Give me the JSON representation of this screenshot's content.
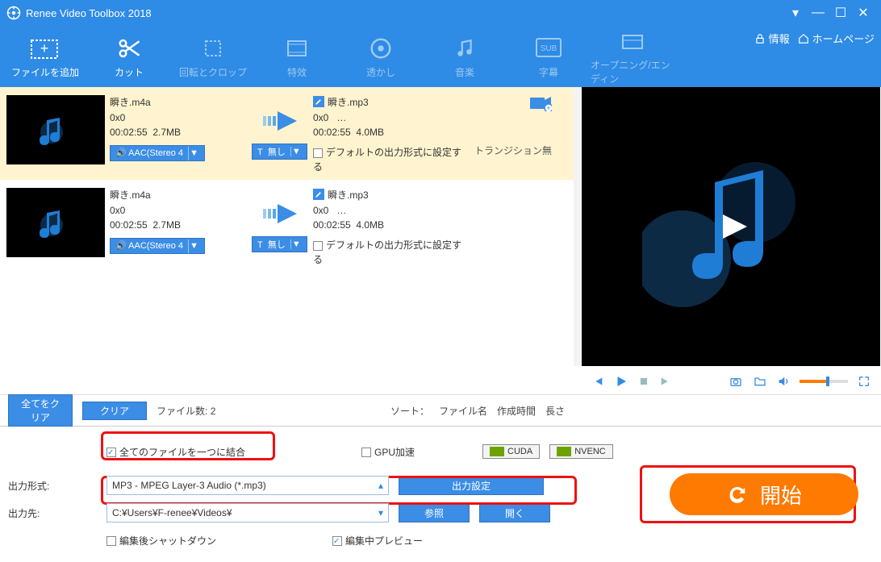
{
  "title": "Renee Video Toolbox 2018",
  "header_links": {
    "info": "情報",
    "home": "ホームページ"
  },
  "tools": [
    {
      "label": "ファイルを追加",
      "active": true
    },
    {
      "label": "カット",
      "active": true
    },
    {
      "label": "回転とクロップ",
      "active": false
    },
    {
      "label": "特效",
      "active": false
    },
    {
      "label": "透かし",
      "active": false
    },
    {
      "label": "音楽",
      "active": false
    },
    {
      "label": "字幕",
      "active": false
    },
    {
      "label": "オープニング/エンディン",
      "active": false
    }
  ],
  "files": [
    {
      "selected": true,
      "src_name": "瞬き.m4a",
      "src_res": "0x0",
      "src_dur": "00:02:55",
      "src_size": "2.7MB",
      "dst_name": "瞬き.mp3",
      "dst_res": "0x0",
      "dst_extra": "…",
      "dst_dur": "00:02:55",
      "dst_size": "4.0MB",
      "transition": "トランジション無",
      "audio_sel": "AAC(Stereo 4",
      "sub_sel": "無し",
      "default_fmt": "デフォルトの出力形式に設定する"
    },
    {
      "selected": false,
      "src_name": "瞬き.m4a",
      "src_res": "0x0",
      "src_dur": "00:02:55",
      "src_size": "2.7MB",
      "dst_name": "瞬き.mp3",
      "dst_res": "0x0",
      "dst_extra": "…",
      "dst_dur": "00:02:55",
      "dst_size": "4.0MB",
      "transition": "",
      "audio_sel": "AAC(Stereo 4",
      "sub_sel": "無し",
      "default_fmt": "デフォルトの出力形式に設定する"
    }
  ],
  "listbar": {
    "clear_all": "全てをクリア",
    "clear": "クリア",
    "count_label": "ファイル数:",
    "count": "2",
    "sort_label": "ソート：",
    "sort_file": "ファイル名",
    "sort_time": "作成時間",
    "sort_len": "長さ"
  },
  "options": {
    "merge": "全てのファイルを一つに結合",
    "gpu": "GPU加速",
    "cuda": "CUDA",
    "nvenc": "NVENC",
    "format_label": "出力形式:",
    "format_value": "MP3 - MPEG Layer-3 Audio (*.mp3)",
    "settings": "出力設定",
    "dest_label": "出力先:",
    "dest_value": "C:¥Users¥F-renee¥Videos¥",
    "browse": "参照",
    "open": "開く",
    "shutdown": "編集後シャットダウン",
    "preview": "編集中プレビュー",
    "start": "開始"
  }
}
